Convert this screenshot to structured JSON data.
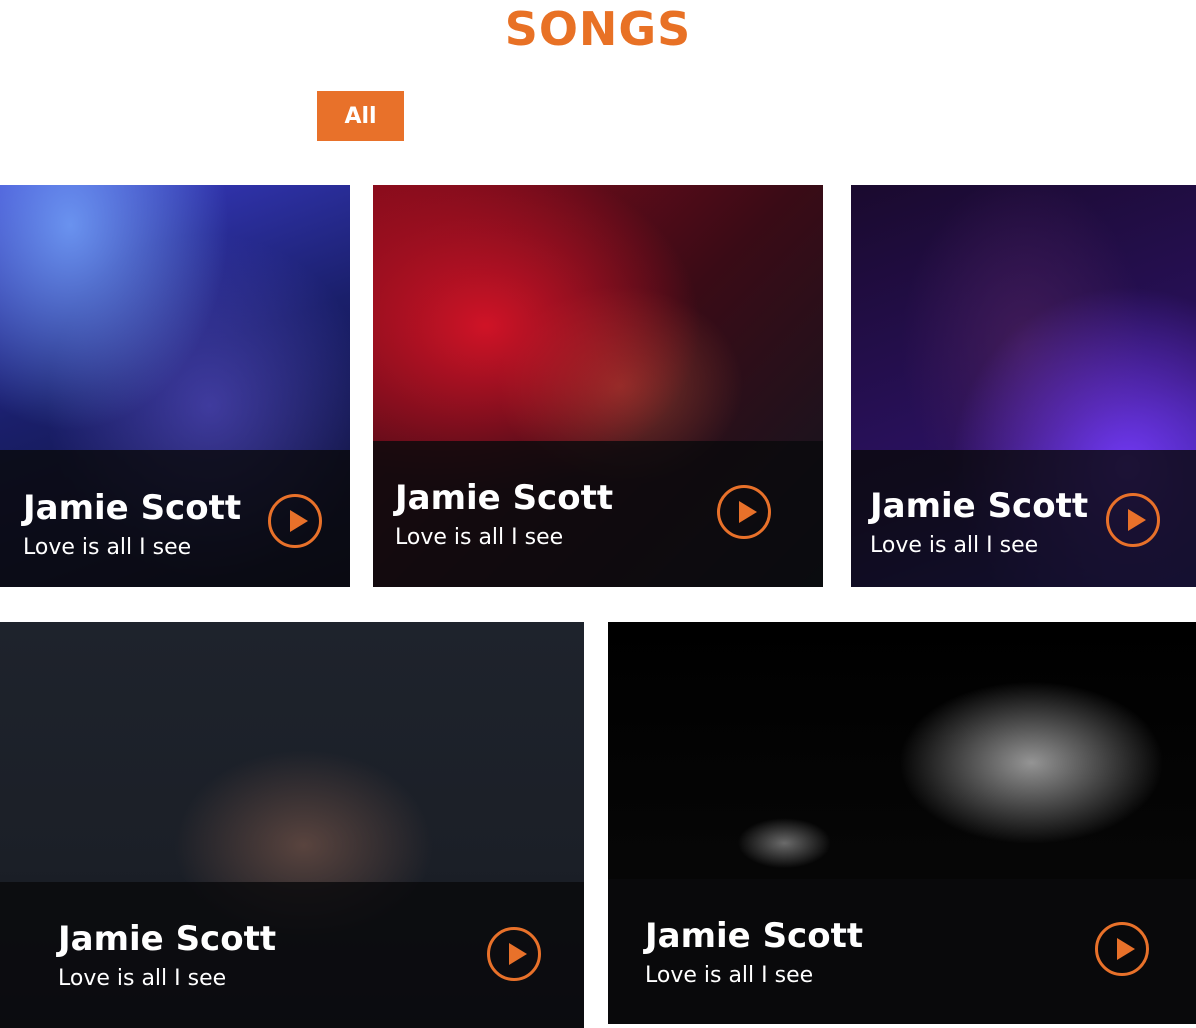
{
  "section": {
    "title": "SONGS"
  },
  "filters": [
    {
      "label": "All",
      "active": true
    }
  ],
  "accent_color": "#e8712a",
  "songs": [
    {
      "artist": "Jamie Scott",
      "title": "Love is all I see",
      "icon": "play-icon"
    },
    {
      "artist": "Jamie Scott",
      "title": "Love is all I see",
      "icon": "play-icon"
    },
    {
      "artist": "Jamie Scott",
      "title": "Love is all I see",
      "icon": "play-icon"
    },
    {
      "artist": "Jamie Scott",
      "title": "Love is all I see",
      "icon": "play-icon"
    },
    {
      "artist": "Jamie Scott",
      "title": "Love is all I see",
      "icon": "play-icon"
    }
  ]
}
